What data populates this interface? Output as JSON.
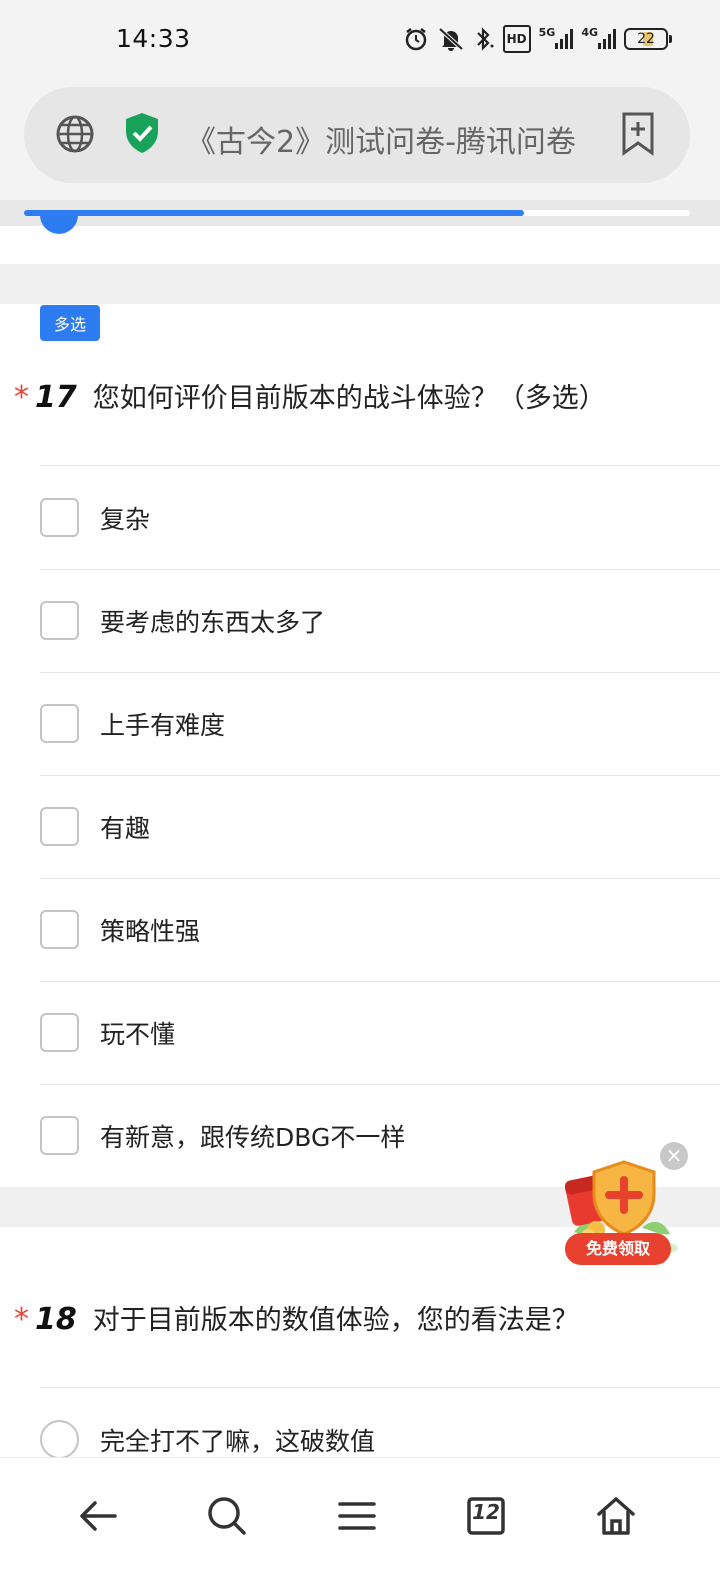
{
  "status_bar": {
    "time": "14:33",
    "icons": [
      "alarm-icon",
      "mute-icon",
      "bluetooth-icon",
      "hd-voice-icon",
      "5g-signal-icon",
      "4g-signal-icon",
      "battery-icon"
    ],
    "hd_label": "HD",
    "net_5g": "5G",
    "net_4g": "4G",
    "battery_level": "22"
  },
  "address_bar": {
    "title": "《古今2》测试问卷-腾讯问卷",
    "icons": [
      "globe-icon",
      "shield-check-icon",
      "bookmark-add-icon"
    ],
    "secure_color": "#19a35a"
  },
  "progress": {
    "fraction": 0.75,
    "color": "#2d7cf1"
  },
  "question17": {
    "tag": "多选",
    "required_mark": "*",
    "number": "17",
    "title": "您如何评价目前版本的战斗体验？（多选）",
    "options": [
      "复杂",
      "要考虑的东西太多了",
      "上手有难度",
      "有趣",
      "策略性强",
      "玩不懂",
      "有新意，跟传统DBG不一样"
    ]
  },
  "promo": {
    "label": "免费领取",
    "close": "×",
    "icons": [
      "red-envelope-icon",
      "shield-plus-icon",
      "close-icon"
    ]
  },
  "question18": {
    "required_mark": "*",
    "number": "18",
    "title": "对于目前版本的数值体验，您的看法是？",
    "options": [
      "完全打不了嘛，这破数值"
    ]
  },
  "bottom_nav": {
    "icons": [
      "back-arrow-icon",
      "search-icon",
      "menu-icon",
      "tabs-icon",
      "home-icon"
    ],
    "tab_count": "12"
  },
  "colors": {
    "accent": "#2d7cf1",
    "required": "#e2463a"
  }
}
